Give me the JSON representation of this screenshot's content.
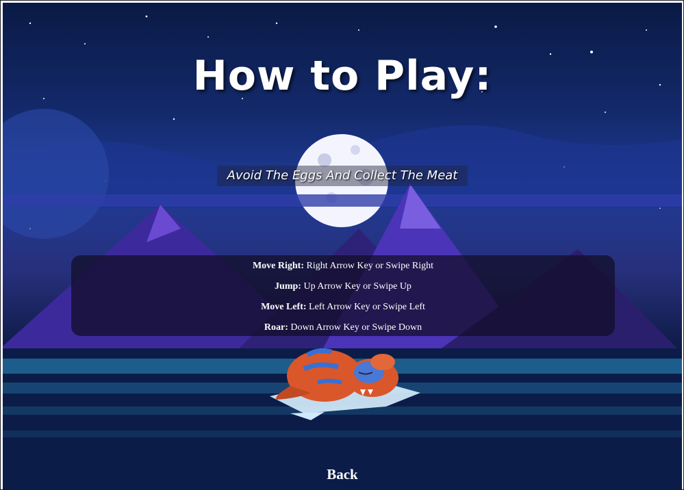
{
  "title": "How to Play:",
  "subtitle": "Avoid The Eggs And Collect The Meat",
  "controls": [
    {
      "key": "Move Right:",
      "desc": " Right Arrow Key or Swipe Right"
    },
    {
      "key": "Jump:",
      "desc": " Up Arrow Key or Swipe Up"
    },
    {
      "key": "Move Left:",
      "desc": " Left Arrow Key or Swipe Left"
    },
    {
      "key": "Roar:",
      "desc": " Down Arrow Key or Swipe Down"
    }
  ],
  "back_label": "Back",
  "colors": {
    "sky": "#13296a",
    "mountain": "#4b2fb0",
    "dino": "#d9572a",
    "dino_stripes": "#3a6fd4",
    "panel": "#120c26"
  },
  "icons": [
    "moon-image",
    "planet-image",
    "mountains-image",
    "dinosaur-sleeping-image"
  ]
}
